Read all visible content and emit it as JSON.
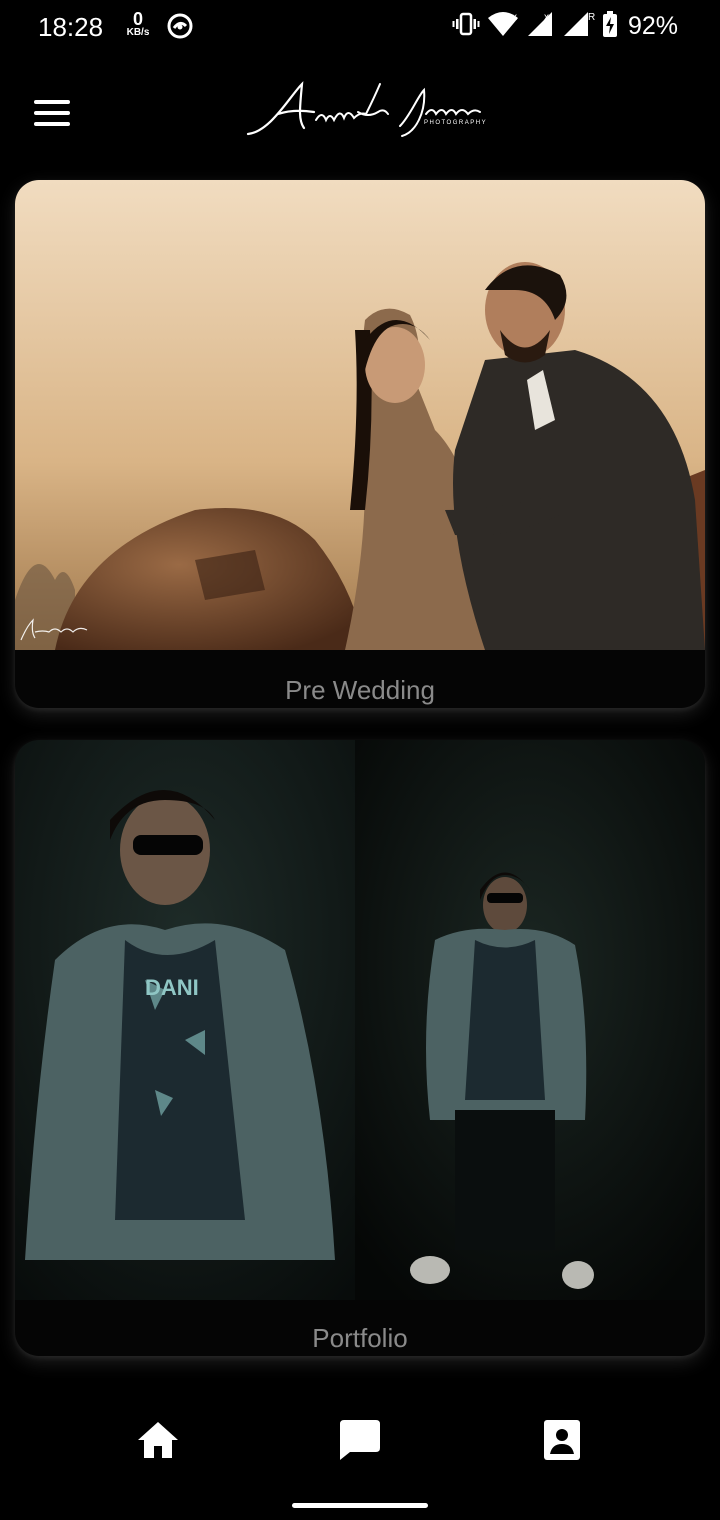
{
  "status_bar": {
    "time": "18:28",
    "net_speed_value": "0",
    "net_speed_unit": "KB/s",
    "battery_percent": "92%",
    "icons": [
      "vibrate-icon",
      "wifi-icon",
      "signal-icon",
      "signal-roaming-icon",
      "battery-charging-icon"
    ]
  },
  "app_bar": {
    "menu_icon": "hamburger-menu-icon",
    "logo_text": "Aniket Jadhav",
    "logo_subtext": "PHOTOGRAPHY"
  },
  "categories": [
    {
      "label": "Pre Wedding",
      "image": "couple-pre-wedding-photo"
    },
    {
      "label": "Portfolio",
      "image": "portfolio-man-jacket-photo"
    }
  ],
  "bottom_nav": {
    "items": [
      "home-icon",
      "chat-icon",
      "contact-icon"
    ]
  },
  "colors": {
    "background": "#000000",
    "card": "#050505",
    "label": "#8a8a8a"
  }
}
